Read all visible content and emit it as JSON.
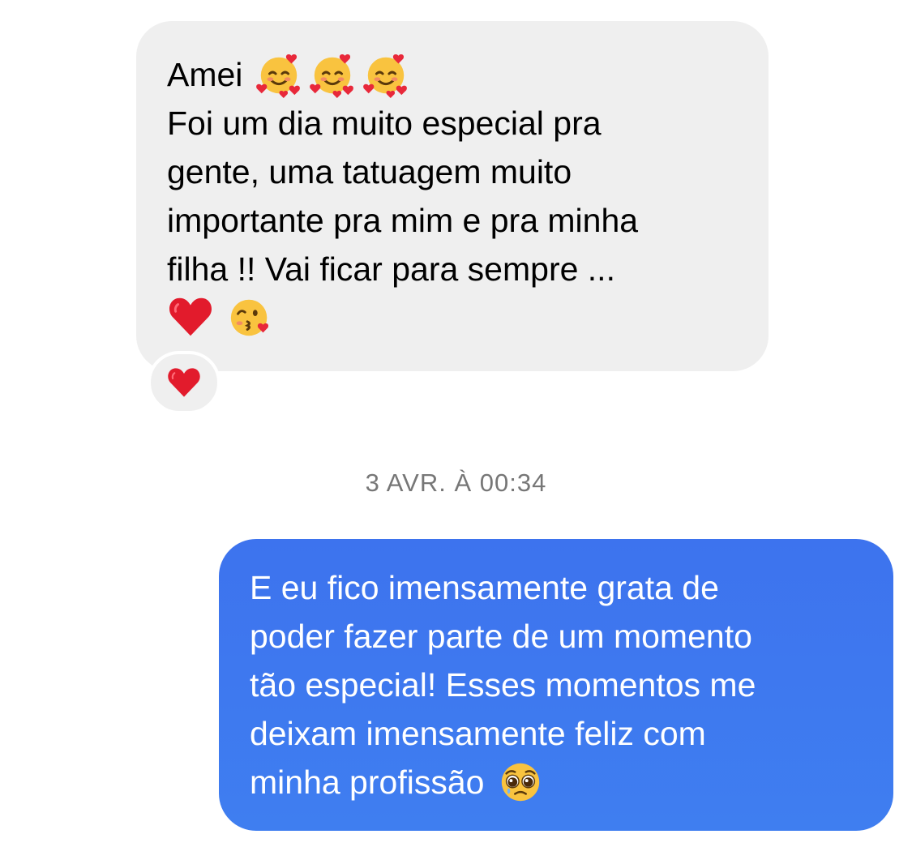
{
  "messages": {
    "incoming": {
      "line1": "Amei",
      "line2": "Foi um dia muito especial pra",
      "line3": "gente, uma tatuagem muito",
      "line4": "importante pra mim e pra minha",
      "line5": "filha !! Vai ficar para sempre ...",
      "line1_emojis": [
        "smiling-face-with-hearts-icon",
        "smiling-face-with-hearts-icon",
        "smiling-face-with-hearts-icon"
      ],
      "line6_emojis": [
        "red-heart-icon",
        "face-blowing-kiss-icon"
      ],
      "reaction": "red-heart-icon"
    },
    "timestamp": "3 AVR. À 00:34",
    "outgoing": {
      "line1": "E eu fico imensamente grata de",
      "line2": "poder fazer parte de um momento",
      "line3": "tão especial! Esses momentos me",
      "line4": "deixam imensamente feliz com",
      "line5": "minha profissão",
      "line5_emoji": "pleading-face-icon",
      "bubble_color": "#3d77ef"
    }
  },
  "colors": {
    "incoming_bubble": "#efefef",
    "outgoing_bubble": "#3d77ef",
    "timestamp_text": "#777777"
  }
}
